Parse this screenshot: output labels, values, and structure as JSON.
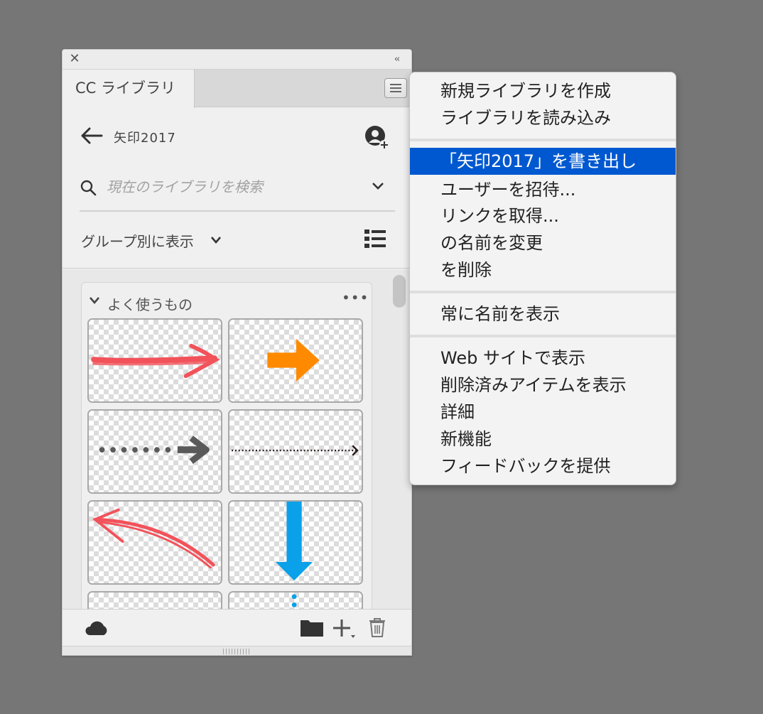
{
  "panel": {
    "tab_label": "CC ライブラリ",
    "library_name": "矢印2017",
    "search_placeholder": "現在のライブラリを検索",
    "group_by_label": "グループ別に表示",
    "group": {
      "name": "よく使うもの",
      "more": "•••",
      "tiles": [
        {
          "name": "red-handdrawn-arrow-right",
          "color": "#f2525a"
        },
        {
          "name": "orange-bold-arrow-right",
          "color": "#ff8a00"
        },
        {
          "name": "gray-dotted-arrow-right",
          "color": "#5a5a5a"
        },
        {
          "name": "black-fine-dotted-arrow-right",
          "color": "#2a1a1a"
        },
        {
          "name": "red-curved-arrow-left",
          "color": "#f2525a"
        },
        {
          "name": "blue-arrow-down",
          "color": "#0aa0ea"
        },
        {
          "name": "partial-tile-left",
          "color": "#cccccc"
        },
        {
          "name": "blue-dotted-partial",
          "color": "#0aa0ea"
        }
      ]
    },
    "icons": {
      "close": "✕",
      "collapse": "‹‹",
      "back": "back-arrow-icon",
      "add_user": "add-user-icon",
      "search": "search-icon",
      "list_view": "list-view-icon",
      "cloud": "cloud-icon",
      "folder": "folder-icon",
      "plus": "plus-icon",
      "trash": "trash-icon"
    }
  },
  "menu": {
    "highlight_color": "#0058d0",
    "sections": [
      [
        "新規ライブラリを作成",
        "ライブラリを読み込み"
      ],
      [
        "「矢印2017」を書き出し",
        "ユーザーを招待...",
        "リンクを取得...",
        "の名前を変更",
        "を削除"
      ],
      [
        "常に名前を表示"
      ],
      [
        "Web サイトで表示",
        "削除済みアイテムを表示",
        "詳細",
        "新機能",
        "フィードバックを提供"
      ]
    ],
    "selected_item": "「矢印2017」を書き出し"
  }
}
